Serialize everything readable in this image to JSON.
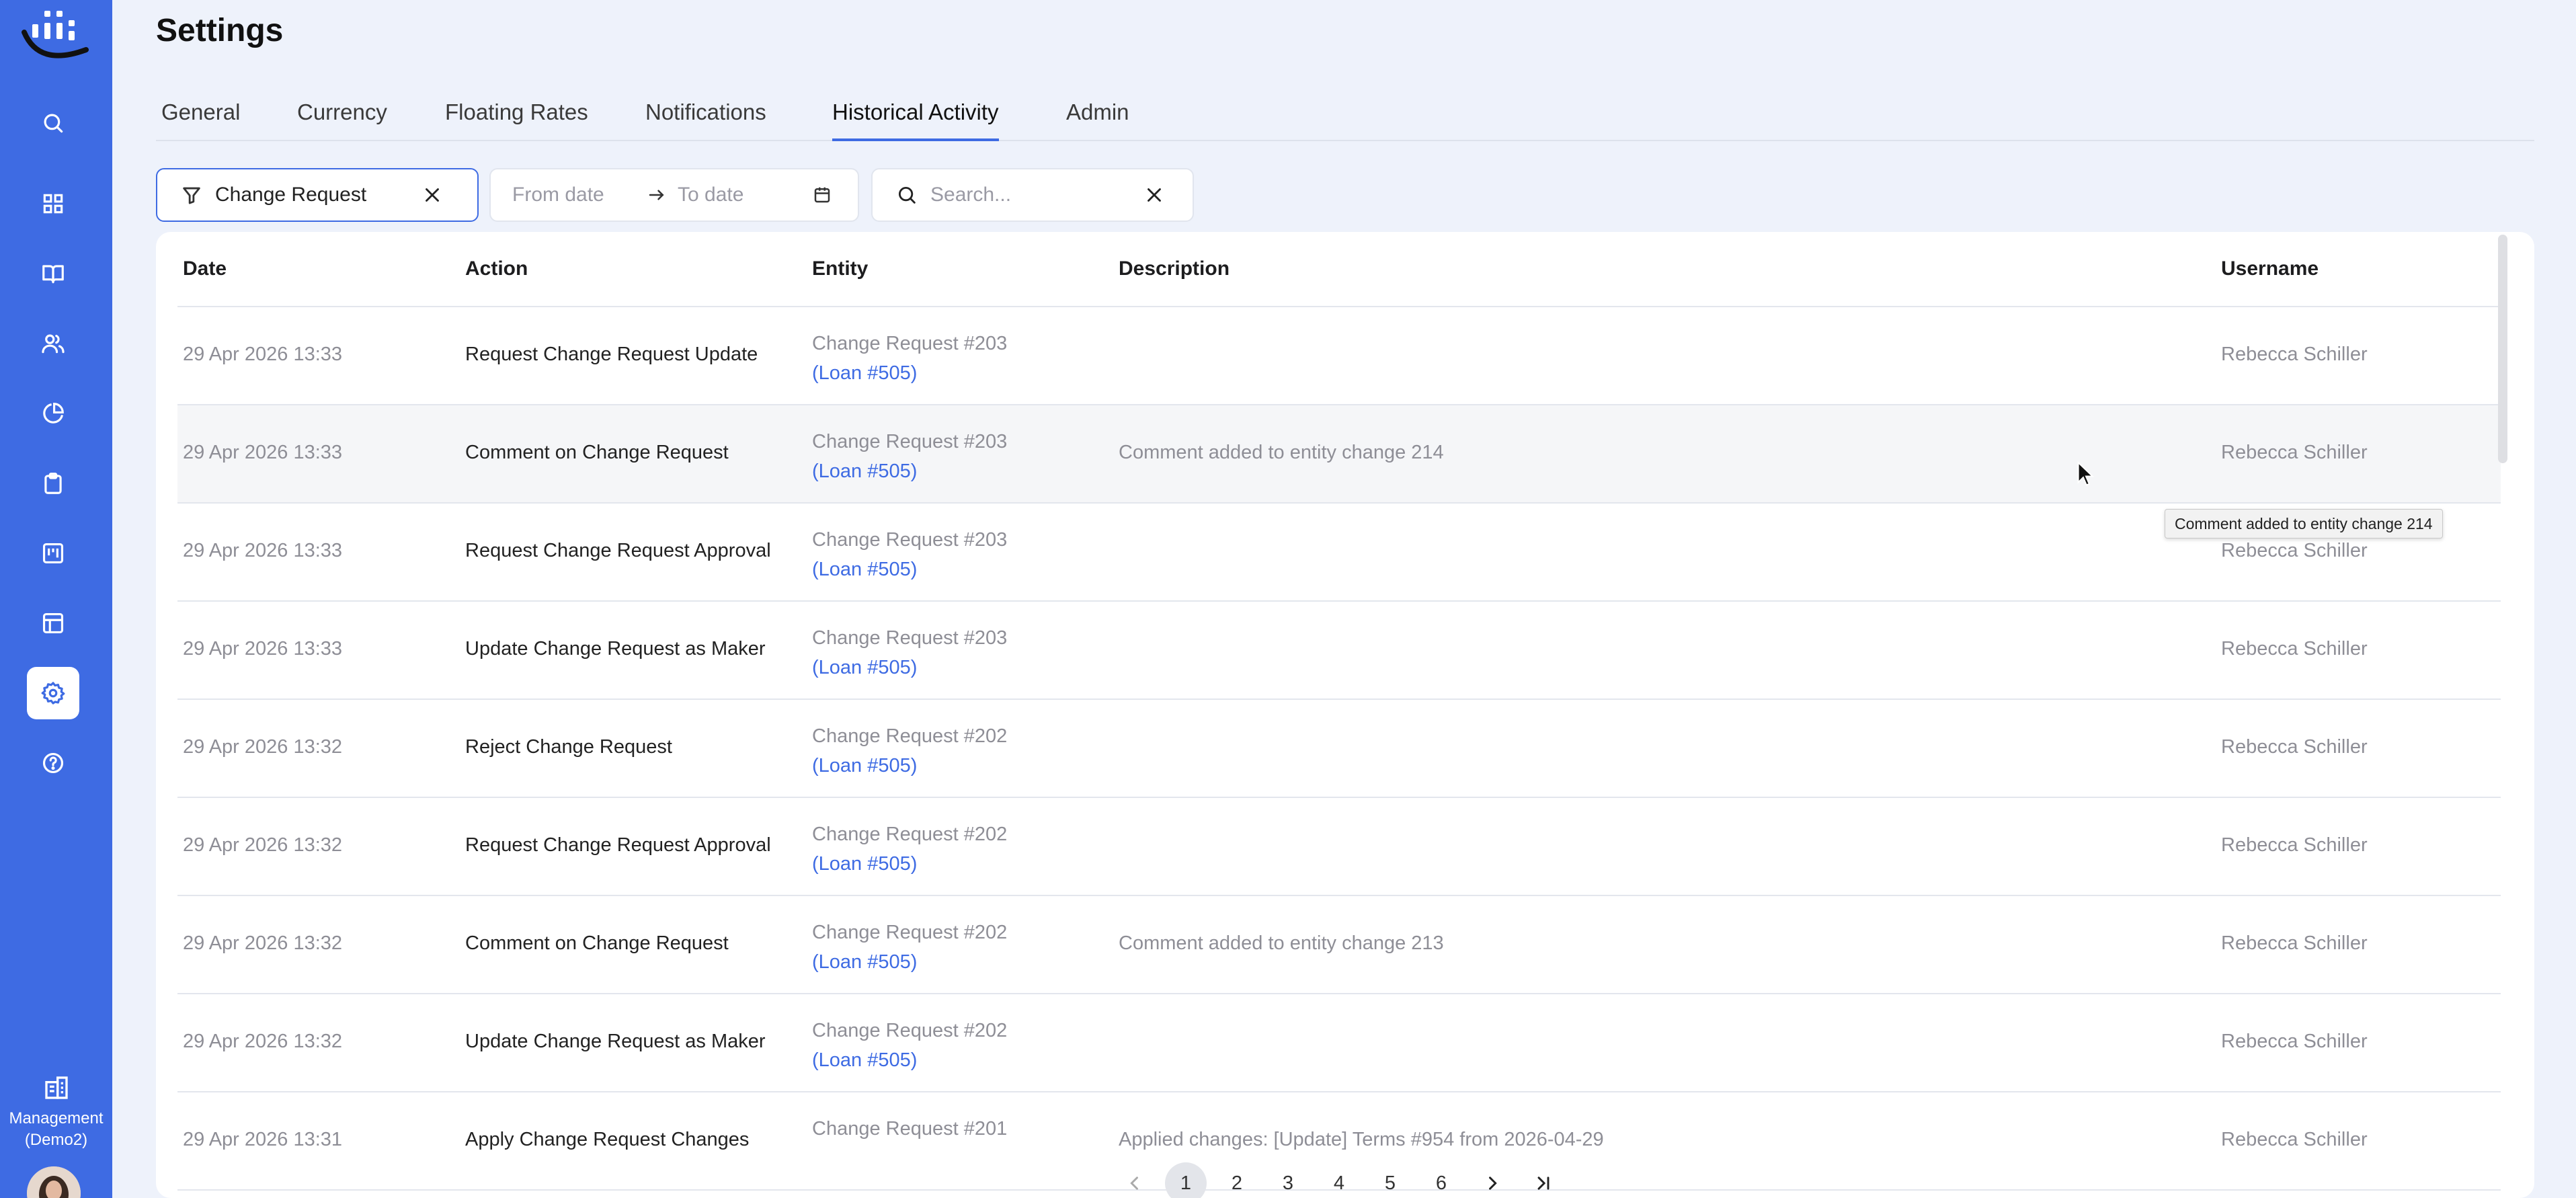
{
  "app": {
    "org_label_line1": "Management",
    "org_label_line2": "(Demo2)"
  },
  "sidebar": {
    "items": [
      {
        "icon": "search-icon",
        "active": false
      },
      {
        "icon": "dashboard-grid-icon",
        "active": false
      },
      {
        "icon": "book-icon",
        "active": false
      },
      {
        "icon": "users-icon",
        "active": false
      },
      {
        "icon": "pie-chart-icon",
        "active": false
      },
      {
        "icon": "clipboard-icon",
        "active": false
      },
      {
        "icon": "board-icon",
        "active": false
      },
      {
        "icon": "table-icon",
        "active": false
      },
      {
        "icon": "gear-icon",
        "active": true
      },
      {
        "icon": "help-icon",
        "active": false
      }
    ]
  },
  "header": {
    "title": "Settings",
    "tabs": [
      {
        "label": "General"
      },
      {
        "label": "Currency"
      },
      {
        "label": "Floating Rates"
      },
      {
        "label": "Notifications"
      },
      {
        "label": "Historical Activity",
        "active": true
      },
      {
        "label": "Admin"
      }
    ]
  },
  "filters": {
    "type_value": "Change Request",
    "from_placeholder": "From date",
    "to_placeholder": "To date",
    "search_placeholder": "Search..."
  },
  "table": {
    "columns": {
      "date": "Date",
      "action": "Action",
      "entity": "Entity",
      "description": "Description",
      "username": "Username"
    },
    "rows": [
      {
        "date": "29 Apr 2026 13:33",
        "action": "Request Change Request Update",
        "entity": "Change Request #203",
        "entity_link": "(Loan #505)",
        "description": "",
        "username": "Rebecca Schiller"
      },
      {
        "date": "29 Apr 2026 13:33",
        "action": "Comment on Change Request",
        "entity": "Change Request #203",
        "entity_link": "(Loan #505)",
        "description": "Comment added to entity change 214",
        "username": "Rebecca Schiller"
      },
      {
        "date": "29 Apr 2026 13:33",
        "action": "Request Change Request Approval",
        "entity": "Change Request #203",
        "entity_link": "(Loan #505)",
        "description": "",
        "username": "Rebecca Schiller"
      },
      {
        "date": "29 Apr 2026 13:33",
        "action": "Update Change Request as Maker",
        "entity": "Change Request #203",
        "entity_link": "(Loan #505)",
        "description": "",
        "username": "Rebecca Schiller"
      },
      {
        "date": "29 Apr 2026 13:32",
        "action": "Reject Change Request",
        "entity": "Change Request #202",
        "entity_link": "(Loan #505)",
        "description": "",
        "username": "Rebecca Schiller"
      },
      {
        "date": "29 Apr 2026 13:32",
        "action": "Request Change Request Approval",
        "entity": "Change Request #202",
        "entity_link": "(Loan #505)",
        "description": "",
        "username": "Rebecca Schiller"
      },
      {
        "date": "29 Apr 2026 13:32",
        "action": "Comment on Change Request",
        "entity": "Change Request #202",
        "entity_link": "(Loan #505)",
        "description": "Comment added to entity change 213",
        "username": "Rebecca Schiller"
      },
      {
        "date": "29 Apr 2026 13:32",
        "action": "Update Change Request as Maker",
        "entity": "Change Request #202",
        "entity_link": "(Loan #505)",
        "description": "",
        "username": "Rebecca Schiller"
      },
      {
        "date": "29 Apr 2026 13:31",
        "action": "Apply Change Request Changes",
        "entity": "Change Request #201",
        "entity_link": "",
        "description": "Applied changes: [Update] Terms #954 from 2026-04-29",
        "username": "Rebecca Schiller"
      }
    ]
  },
  "pagination": {
    "pages": [
      "1",
      "2",
      "3",
      "4",
      "5",
      "6"
    ],
    "current": "1"
  },
  "tooltip": {
    "text": "Comment added to entity change 214"
  },
  "colors": {
    "sidebar": "#3e6be3",
    "accent": "#3e6be3",
    "background": "#eef2fb"
  }
}
